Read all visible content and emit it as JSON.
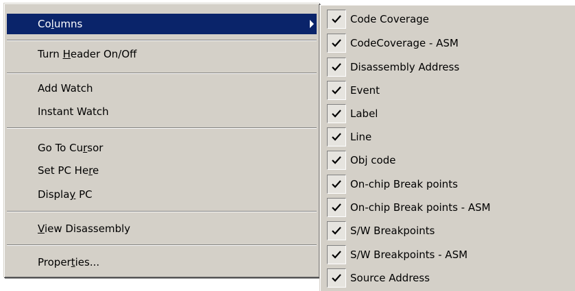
{
  "menu": {
    "columns": {
      "pre": "Co",
      "mn": "l",
      "post": "umns"
    },
    "header": {
      "pre": "Turn ",
      "mn": "H",
      "post": "eader On/Off"
    },
    "add_watch": "Add Watch",
    "instant_watch": "Instant Watch",
    "go_to_cursor": {
      "pre": "Go To Cu",
      "mn": "r",
      "post": "sor"
    },
    "set_pc": {
      "pre": "Set PC He",
      "mn": "r",
      "post": "e"
    },
    "display_pc": {
      "pre": "Displa",
      "mn": "y",
      "post": " PC"
    },
    "view_disassembly": {
      "pre": "",
      "mn": "V",
      "post": "iew Disassembly"
    },
    "properties": {
      "pre": "Proper",
      "mn": "t",
      "post": "ies..."
    }
  },
  "submenu": {
    "items": [
      {
        "label": "Code Coverage",
        "checked": true
      },
      {
        "label": "CodeCoverage - ASM",
        "checked": true
      },
      {
        "label": "Disassembly Address",
        "checked": true
      },
      {
        "label": "Event",
        "checked": true
      },
      {
        "label": "Label",
        "checked": true
      },
      {
        "label": "Line",
        "checked": true
      },
      {
        "label": "Obj code",
        "checked": true
      },
      {
        "label": "On-chip Break points",
        "checked": true
      },
      {
        "label": "On-chip Break points - ASM",
        "checked": true
      },
      {
        "label": "S/W Breakpoints",
        "checked": true
      },
      {
        "label": "S/W Breakpoints - ASM",
        "checked": true
      },
      {
        "label": "Source Address",
        "checked": true
      }
    ]
  },
  "colors": {
    "menu_bg": "#d4d0c8",
    "highlight": "#0a246a",
    "highlight_text": "#ffffff"
  },
  "icons": [
    "submenu-arrow-icon",
    "checkmark-icon"
  ]
}
